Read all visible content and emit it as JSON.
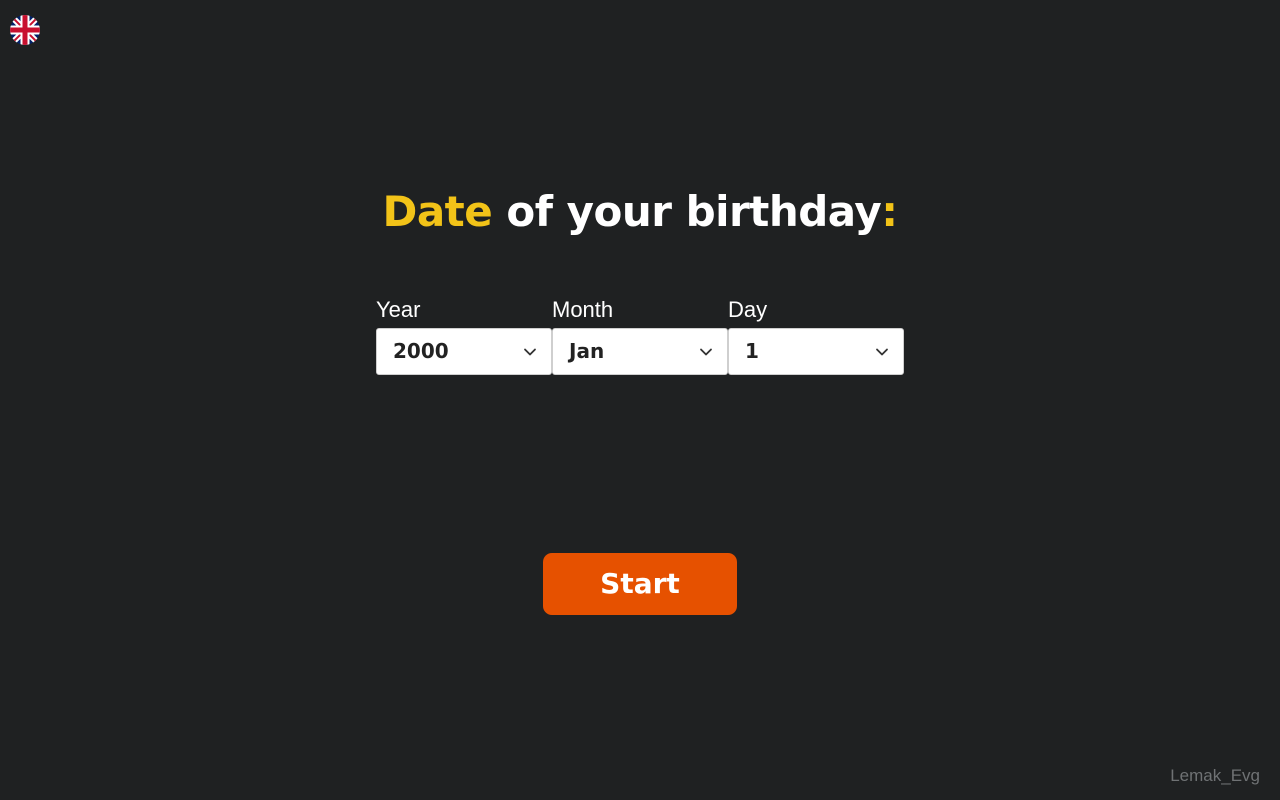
{
  "header": {
    "language_icon": "uk-flag-icon"
  },
  "title": {
    "accent": "Date",
    "main": " of your birthday",
    "colon": ":"
  },
  "form": {
    "year": {
      "label": "Year",
      "value": "2000"
    },
    "month": {
      "label": "Month",
      "value": "Jan"
    },
    "day": {
      "label": "Day",
      "value": "1"
    }
  },
  "start_label": "Start",
  "footer": {
    "credit": "Lemak_Evg"
  },
  "colors": {
    "background": "#1f2122",
    "accent": "#f2c318",
    "button": "#e65100",
    "credit_text": "#6f7274"
  }
}
